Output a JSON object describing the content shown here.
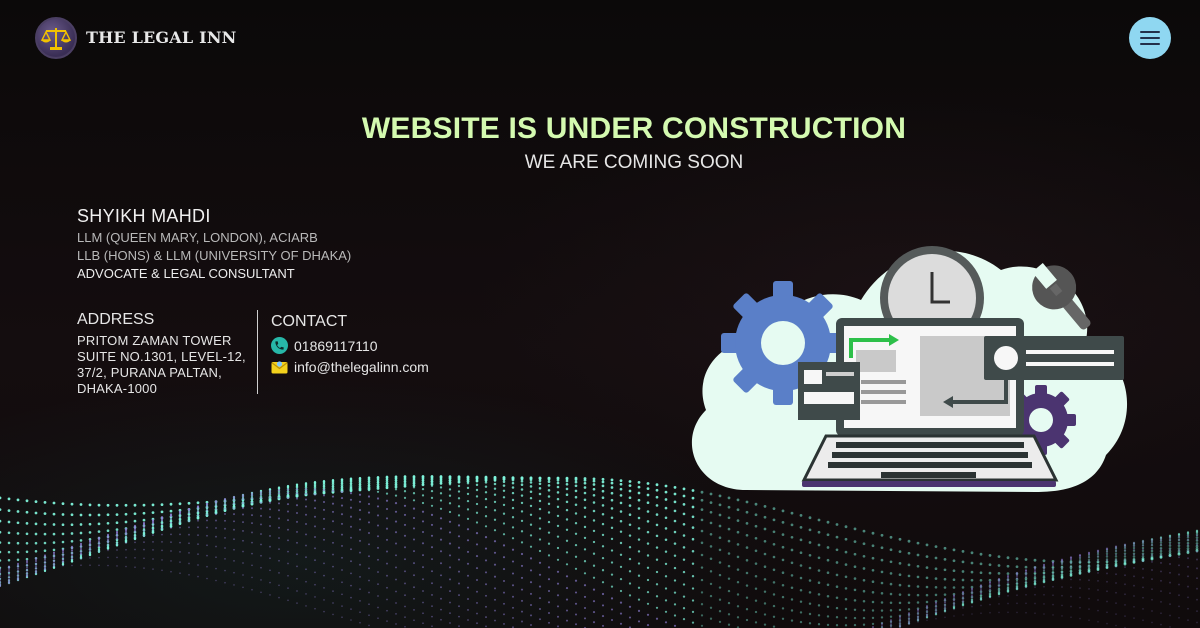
{
  "header": {
    "brand_name": "THE LEGAL INN",
    "logo_icon": "scales-of-justice-icon",
    "menu_icon": "hamburger-menu-icon",
    "menu_button_color": "#8fd7f1"
  },
  "hero": {
    "title": "WEBSITE IS UNDER CONSTRUCTION",
    "subtitle": "WE ARE COMING SOON",
    "title_color": "#d4fab0"
  },
  "profile": {
    "name": "SHYIKH MAHDI",
    "qualification_1": "LLM (QUEEN MARY, LONDON), ACIARB",
    "qualification_2": "LLB (HONS) & LLM (UNIVERSITY OF DHAKA)",
    "role": "ADVOCATE & LEGAL CONSULTANT"
  },
  "address": {
    "heading": "ADDRESS",
    "line_1": "PRITOM ZAMAN TOWER",
    "line_2": "SUITE NO.1301, LEVEL-12,",
    "line_3": "37/2, PURANA PALTAN,",
    "line_4": "DHAKA-1000"
  },
  "contact": {
    "heading": "CONTACT",
    "phone": "01869117110",
    "phone_icon": "phone-icon",
    "email": "info@thelegalinn.com",
    "email_icon": "envelope-icon"
  },
  "illustration": {
    "name": "laptop-under-construction-illustration",
    "cloud_color": "#e6fbf2",
    "gear_color_1": "#5a7fc8",
    "gear_color_2": "#4b3470",
    "accent_green": "#2ec04a"
  }
}
